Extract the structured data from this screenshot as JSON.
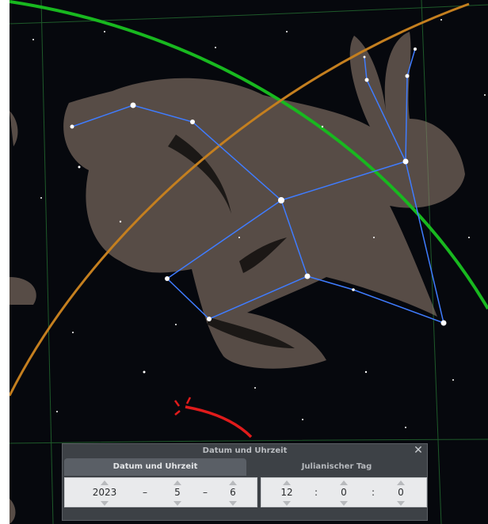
{
  "dialog": {
    "title": "Datum und Uhrzeit",
    "close_icon": "close-icon",
    "tabs": [
      {
        "label": "Datum und Uhrzeit",
        "active": true
      },
      {
        "label": "Julianischer Tag",
        "active": false
      }
    ],
    "date": {
      "year": "2023",
      "month": "5",
      "day": "6",
      "separator": "–"
    },
    "time": {
      "hour": "12",
      "minute": "0",
      "second": "0",
      "separator": ":"
    }
  },
  "sky": {
    "constellation": "lepus",
    "line_color": "#3f7cff",
    "ecliptic_color": "#c47f1f",
    "equator_color": "#18b81f",
    "grid_color": "#1e5a2a",
    "marker_color": "#e01b1b"
  }
}
